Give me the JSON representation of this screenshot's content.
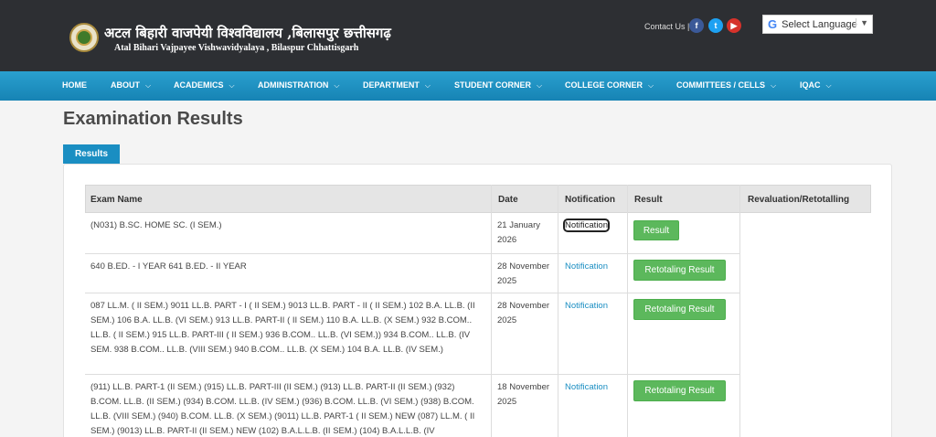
{
  "header": {
    "title_hindi": "अटल बिहारी वाजपेयी विश्वविद्यालय ,बिलासपुर छत्तीसगढ़",
    "title_english": "Atal Bihari Vajpayee Vishwavidyalaya , Bilaspur Chhattisgarh",
    "contact_label": "Contact Us |",
    "language_label": "Select Language",
    "language_arrow": "▼",
    "google_g": "G",
    "social": {
      "facebook": "f",
      "twitter": "t",
      "youtube": "▶"
    }
  },
  "nav": {
    "items": [
      {
        "label": "HOME",
        "has_dropdown": false
      },
      {
        "label": "ABOUT",
        "has_dropdown": true
      },
      {
        "label": "ACADEMICS",
        "has_dropdown": true
      },
      {
        "label": "ADMINISTRATION",
        "has_dropdown": true
      },
      {
        "label": "DEPARTMENT",
        "has_dropdown": true
      },
      {
        "label": "STUDENT CORNER",
        "has_dropdown": true
      },
      {
        "label": "COLLEGE CORNER",
        "has_dropdown": true
      },
      {
        "label": "COMMITTEES / CELLS",
        "has_dropdown": true
      },
      {
        "label": "IQAC",
        "has_dropdown": true
      }
    ],
    "chevron": "⌵"
  },
  "page": {
    "title": "Examination Results",
    "tab_label": "Results"
  },
  "table": {
    "headers": [
      "Exam Name",
      "Date",
      "Notification",
      "Result",
      "Revaluation/Retotalling"
    ],
    "rows": [
      {
        "exam_name": "(N031) B.SC. HOME SC. (I SEM.)",
        "date": "21 January 2026",
        "notification": "Notification",
        "result_button": "Result"
      },
      {
        "exam_name": "640 B.ED. - I YEAR 641 B.ED. - II YEAR",
        "date": "28 November 2025",
        "notification": "Notification",
        "result_button": "Retotaling Result"
      },
      {
        "exam_name": "087 LL.M. ( II SEM.) 9011 LL.B. PART - I ( II SEM.) 9013 LL.B. PART - II ( II SEM.) 102 B.A. LL.B. (II SEM.) 106 B.A. LL.B. (VI SEM.) 913 LL.B. PART-II ( II SEM.) 110 B.A. LL.B. (X SEM.) 932 B.COM.. LL.B. ( II SEM.) 915 LL.B. PART-III ( II SEM.) 936 B.COM.. LL.B. (VI SEM.)) 934 B.COM.. LL.B. (IV SEM. 938 B.COM.. LL.B. (VIII SEM.) 940 B.COM.. LL.B. (X SEM.) 104 B.A. LL.B. (IV SEM.)",
        "date": "28 November 2025",
        "notification": "Notification",
        "result_button": "Retotaling Result"
      },
      {
        "exam_name": "(911) LL.B. PART-1 (II SEM.) (915) LL.B. PART-III (II SEM.) (913) LL.B. PART-II (II SEM.) (932) B.COM. LL.B. (II SEM.) (934) B.COM. LL.B. (IV SEM.) (936) B.COM. LL.B. (VI SEM.) (938) B.COM. LL.B. (VIII SEM.) (940) B.COM. LL.B. (X SEM.) (9011) LL.B. PART-1 ( II SEM.) NEW (087) LL.M. ( II SEM.) (9013) LL.B. PART-II (II SEM.) NEW (102) B.A.L.L.B. (II SEM.) (104) B.A.L.L.B. (IV",
        "date": "18 November 2025",
        "notification": "Notification",
        "result_button": "Retotaling Result"
      }
    ]
  },
  "colors": {
    "header_bg": "#2d2f33",
    "nav_bg": "#1a8ec2",
    "button_green": "#5cb85c",
    "link_blue": "#1a8ec2"
  }
}
